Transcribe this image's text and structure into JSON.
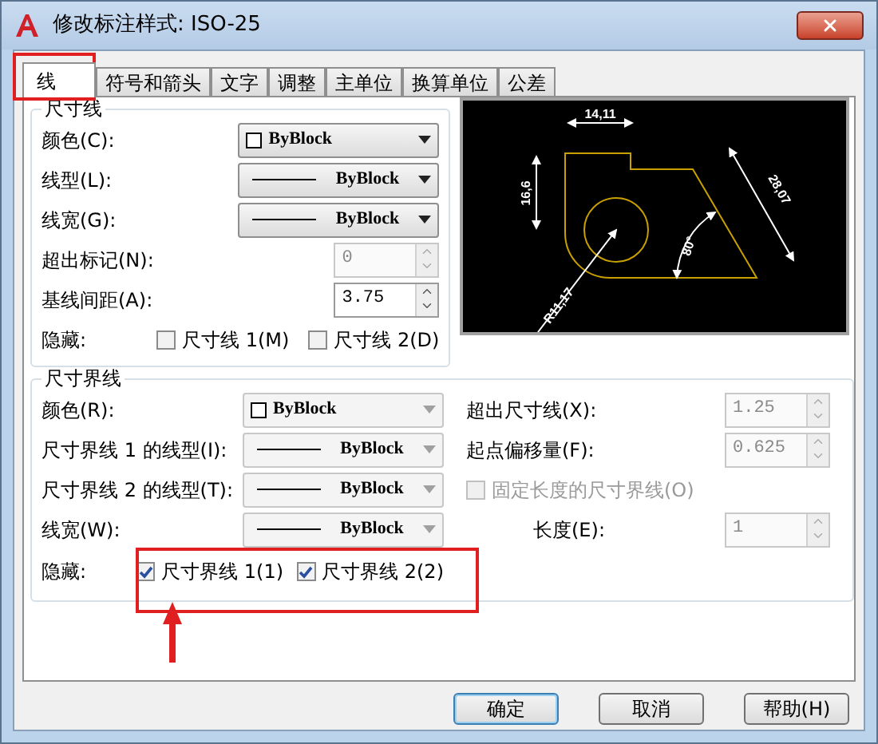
{
  "window": {
    "title": "修改标注样式: ISO-25"
  },
  "tabs": [
    {
      "label": "线",
      "selected": true
    },
    {
      "label": "符号和箭头",
      "selected": false
    },
    {
      "label": "文字",
      "selected": false
    },
    {
      "label": "调整",
      "selected": false
    },
    {
      "label": "主单位",
      "selected": false
    },
    {
      "label": "换算单位",
      "selected": false
    },
    {
      "label": "公差",
      "selected": false
    }
  ],
  "dimension_lines": {
    "title": "尺寸线",
    "fields": [
      {
        "kind": "color",
        "label": "颜色(C):",
        "value": "ByBlock",
        "disabled": false
      },
      {
        "kind": "line",
        "label": "线型(L):",
        "value": "ByBlock",
        "disabled": false
      },
      {
        "kind": "line",
        "label": "线宽(G):",
        "value": "ByBlock",
        "disabled": false
      },
      {
        "kind": "spinner",
        "label": "超出标记(N):",
        "value": "0",
        "disabled": true
      },
      {
        "kind": "spinner",
        "label": "基线间距(A):",
        "value": "3.75",
        "disabled": false
      }
    ],
    "hide": {
      "label": "隐藏:",
      "options": [
        {
          "label": "尺寸线 1(M)",
          "checked": false
        },
        {
          "label": "尺寸线 2(D)",
          "checked": false
        }
      ]
    }
  },
  "preview": {
    "labels": [
      "14,11",
      "16,6",
      "28,07",
      "80°",
      "R11,17"
    ]
  },
  "extension_lines": {
    "title": "尺寸界线",
    "fields": [
      {
        "kind": "color",
        "label": "颜色(R):",
        "value": "ByBlock",
        "disabled": true
      },
      {
        "kind": "line",
        "label": "尺寸界线 1 的线型(I):",
        "value": "ByBlock",
        "disabled": true
      },
      {
        "kind": "line",
        "label": "尺寸界线 2 的线型(T):",
        "value": "ByBlock",
        "disabled": true
      },
      {
        "kind": "line",
        "label": "线宽(W):",
        "value": "ByBlock",
        "disabled": true
      }
    ],
    "hide": {
      "label": "隐藏:",
      "options": [
        {
          "label": "尺寸界线 1(1)",
          "checked": true
        },
        {
          "label": "尺寸界线 2(2)",
          "checked": true
        }
      ]
    },
    "right_fields": [
      {
        "kind": "spinner",
        "label": "超出尺寸线(X):",
        "value": "1.25",
        "disabled": true
      },
      {
        "kind": "spinner",
        "label": "起点偏移量(F):",
        "value": "0.625",
        "disabled": true
      }
    ],
    "fixed_length": {
      "label": "固定长度的尺寸界线(O)",
      "checked": false,
      "disabled": true
    },
    "length": {
      "label": "长度(E):",
      "value": "1",
      "disabled": true
    }
  },
  "buttons": [
    {
      "label": "确定",
      "default": true
    },
    {
      "label": "取消",
      "default": false
    },
    {
      "label": "帮助(H)",
      "default": false
    }
  ]
}
